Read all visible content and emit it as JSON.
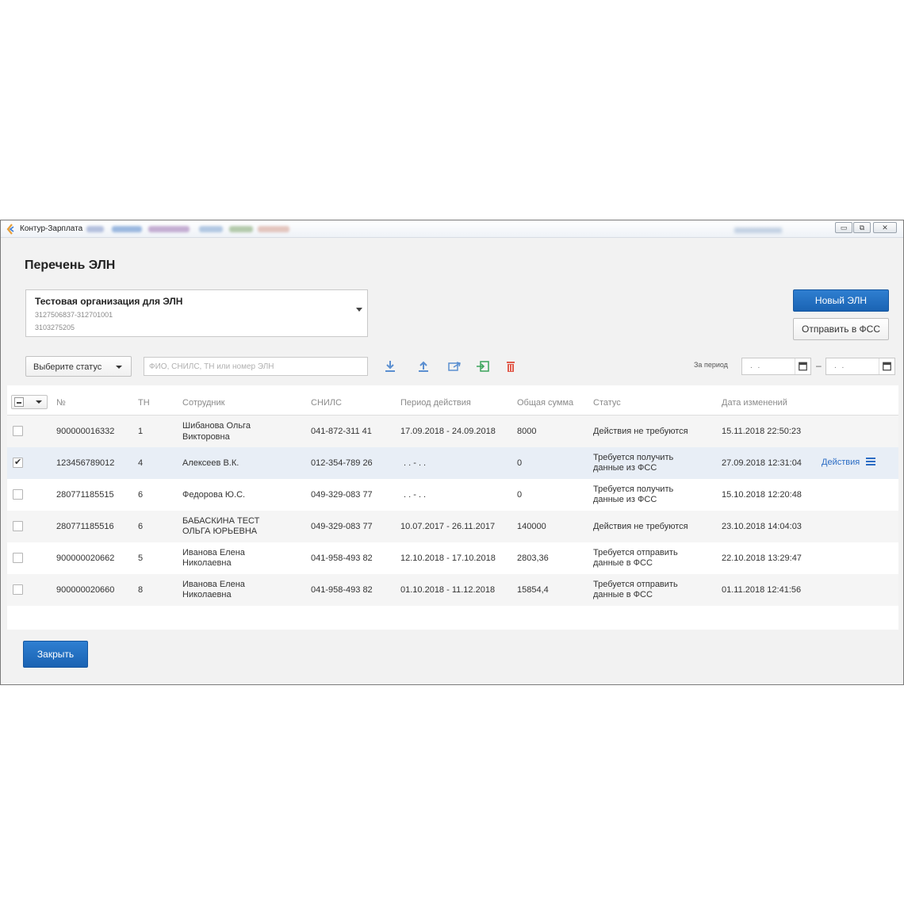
{
  "window": {
    "title": "Контур-Зарплата",
    "controls": {
      "minimize": "▭",
      "restore": "⧉",
      "close": "✕"
    }
  },
  "page": {
    "title": "Перечень ЭЛН"
  },
  "organization": {
    "name": "Тестовая организация для ЭЛН",
    "inn_kpp": "3127506837-312701001",
    "reg_number": "3103275205"
  },
  "buttons": {
    "new_eln": "Новый ЭЛН",
    "send_fss": "Отправить в ФСС",
    "close": "Закрыть"
  },
  "filters": {
    "status_placeholder": "Выберите статус",
    "search_placeholder": "ФИО, СНИЛС, ТН или номер ЭЛН",
    "period_label": "За период",
    "date_from": ". .",
    "date_to": ". .",
    "date_dash": "–"
  },
  "toolbar_icons": [
    "download-icon",
    "upload-icon",
    "export-icon",
    "import-icon",
    "trash-icon"
  ],
  "table": {
    "columns": [
      "№",
      "ТН",
      "Сотрудник",
      "СНИЛС",
      "Период действия",
      "Общая сумма",
      "Статус",
      "Дата изменений"
    ],
    "rows": [
      {
        "checked": false,
        "number": "900000016332",
        "tn": "1",
        "employee": [
          "Шибанова  Ольга",
          "Викторовна"
        ],
        "snils": "041-872-311 41",
        "period": "17.09.2018 - 24.09.2018",
        "sum": "8000",
        "status": [
          "Действия не требуются"
        ],
        "changed": "15.11.2018 22:50:23"
      },
      {
        "checked": true,
        "number": "123456789012",
        "tn": "4",
        "employee": [
          "Алексеев В.К."
        ],
        "snils": "012-354-789 26",
        "period": ". .   -   . .",
        "sum": "0",
        "status": [
          "Требуется получить",
          "данные из ФСС"
        ],
        "changed": "27.09.2018 12:31:04",
        "actions": "Действия"
      },
      {
        "checked": false,
        "number": "280771185515",
        "tn": "6",
        "employee": [
          "Федорова Ю.С."
        ],
        "snils": "049-329-083 77",
        "period": ". .   -   . .",
        "sum": "0",
        "status": [
          "Требуется получить",
          "данные из ФСС"
        ],
        "changed": "15.10.2018 12:20:48"
      },
      {
        "checked": false,
        "number": "280771185516",
        "tn": "6",
        "employee": [
          "БАБАСКИНА ТЕСТ",
          "ОЛЬГА  ЮРЬЕВНА"
        ],
        "snils": "049-329-083 77",
        "period": "10.07.2017 - 26.11.2017",
        "sum": "140000",
        "status": [
          "Действия не требуются"
        ],
        "changed": "23.10.2018 14:04:03"
      },
      {
        "checked": false,
        "number": "900000020662",
        "tn": "5",
        "employee": [
          "Иванова  Елена",
          "Николаевна"
        ],
        "snils": "041-958-493 82",
        "period": "12.10.2018 - 17.10.2018",
        "sum": "2803,36",
        "status": [
          "Требуется отправить",
          "данные в ФСС"
        ],
        "changed": "22.10.2018 13:29:47"
      },
      {
        "checked": false,
        "number": "900000020660",
        "tn": "8",
        "employee": [
          "Иванова  Елена",
          "Николаевна"
        ],
        "snils": "041-958-493 82",
        "period": "01.10.2018 - 11.12.2018",
        "sum": "15854,4",
        "status": [
          "Требуется отправить",
          "данные в ФСС"
        ],
        "changed": "01.11.2018 12:41:56"
      }
    ]
  },
  "colors": {
    "primary": "#1f6cbf",
    "link": "#2b6cc4",
    "trash": "#e05a4b",
    "import": "#3aa35a"
  }
}
